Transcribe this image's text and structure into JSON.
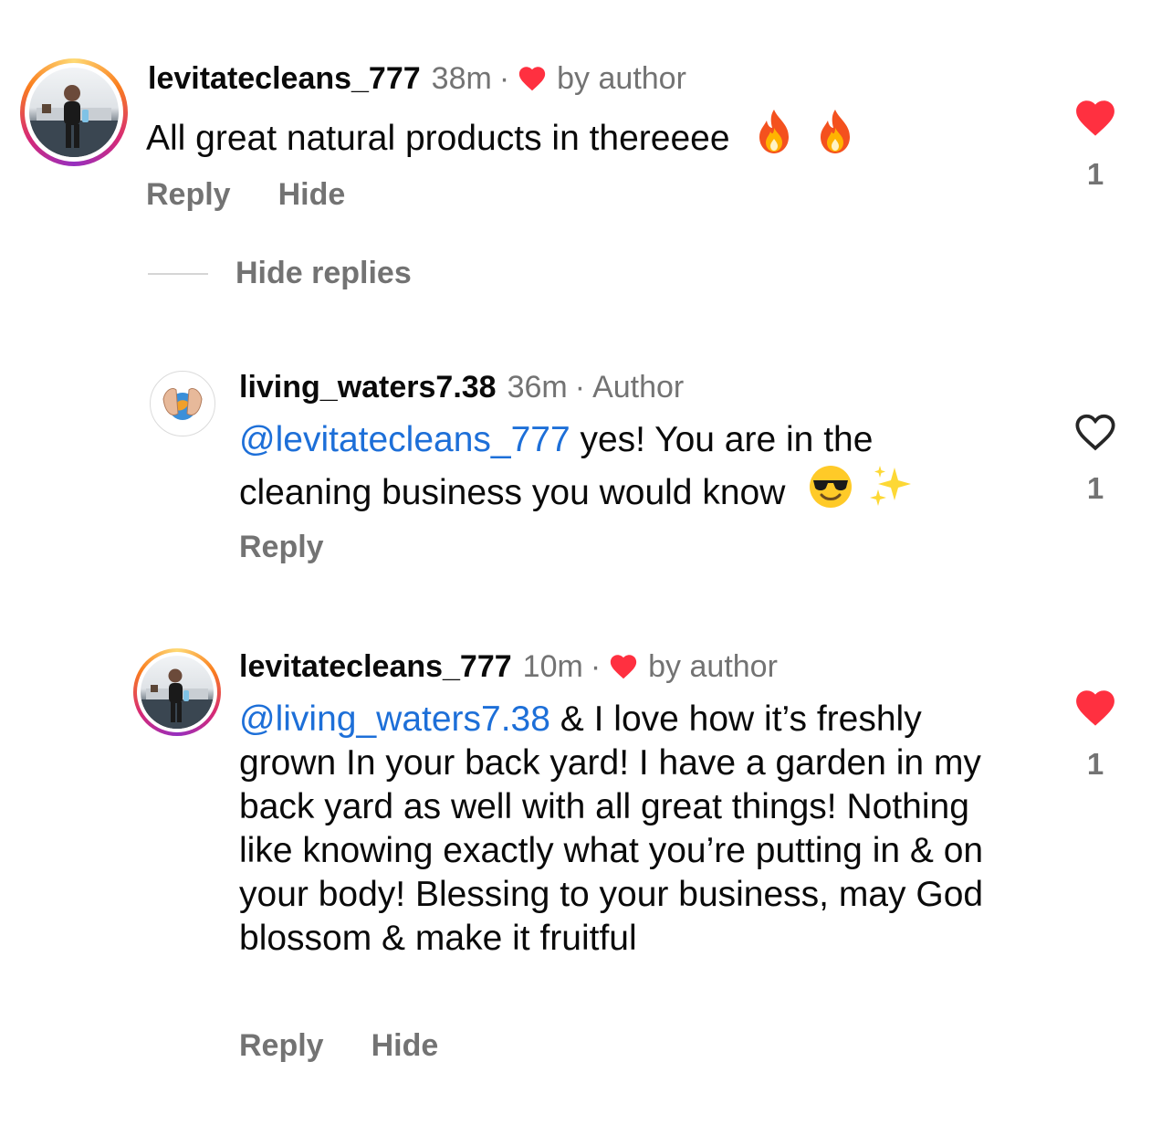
{
  "comments": [
    {
      "username": "levitatecleans_777",
      "time": "38m",
      "dot": "·",
      "badge": "by author",
      "badge_heart": true,
      "text": "All great natural products in thereeee",
      "emojis": [
        "fire",
        "fire"
      ],
      "actions": [
        "Reply",
        "Hide"
      ],
      "liked": true,
      "like_count": "1"
    },
    {
      "username": "living_waters7.38",
      "time": "36m",
      "dot": "·",
      "badge": "Author",
      "mention": "@levitatecleans_777",
      "text": " yes! You are in the cleaning business you would know",
      "emojis": [
        "smiling-face-with-sunglasses",
        "sparkles"
      ],
      "actions": [
        "Reply"
      ],
      "liked": false,
      "like_count": "1"
    },
    {
      "username": "levitatecleans_777",
      "time": "10m",
      "dot": "·",
      "badge": "by author",
      "badge_heart": true,
      "mention": "@living_waters7.38",
      "text": " & I love how it’s freshly grown In your back yard! I have a garden in my back yard as well with all great things! Nothing like knowing exactly what you’re putting in & on your body! Blessing to your business, may God blossom & make it fruitful",
      "actions": [
        "Reply",
        "Hide"
      ],
      "liked": true,
      "like_count": "1"
    }
  ],
  "hide_replies_label": "Hide replies",
  "colors": {
    "like_red": "#ff3040",
    "mention_blue": "#1d6fd8",
    "secondary_gray": "#737373"
  }
}
